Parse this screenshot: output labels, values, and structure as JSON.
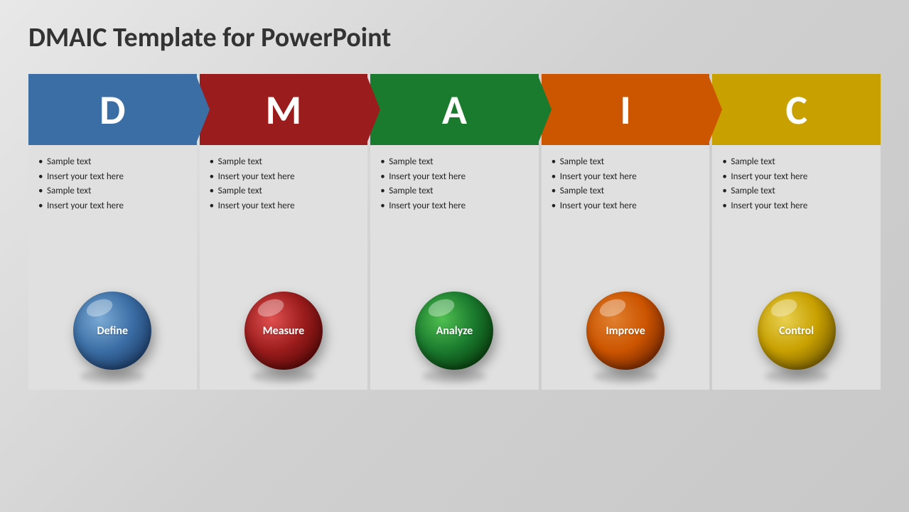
{
  "title": "DMAIC Template for PowerPoint",
  "columns": [
    {
      "id": "d",
      "letter": "D",
      "color": "#3b6ea5",
      "ball_label": "Define",
      "items": [
        "Sample text",
        "Insert your text here",
        "Sample text",
        "Insert your text here"
      ]
    },
    {
      "id": "m",
      "letter": "M",
      "color": "#9b1c1c",
      "ball_label": "Measure",
      "items": [
        "Sample text",
        "Insert your text here",
        "Sample text",
        "Insert your text here"
      ]
    },
    {
      "id": "a",
      "letter": "A",
      "color": "#1a7a2e",
      "ball_label": "Analyze",
      "items": [
        "Sample text",
        "Insert your text here",
        "Sample text",
        "Insert your text here"
      ]
    },
    {
      "id": "i",
      "letter": "I",
      "color": "#cc5500",
      "ball_label": "Improve",
      "items": [
        "Sample text",
        "Insert your text here",
        "Sample text",
        "Insert your text here"
      ]
    },
    {
      "id": "c",
      "letter": "C",
      "color": "#c8a000",
      "ball_label": "Control",
      "items": [
        "Sample text",
        "Insert your text here",
        "Sample text",
        "Insert your text here"
      ]
    }
  ]
}
